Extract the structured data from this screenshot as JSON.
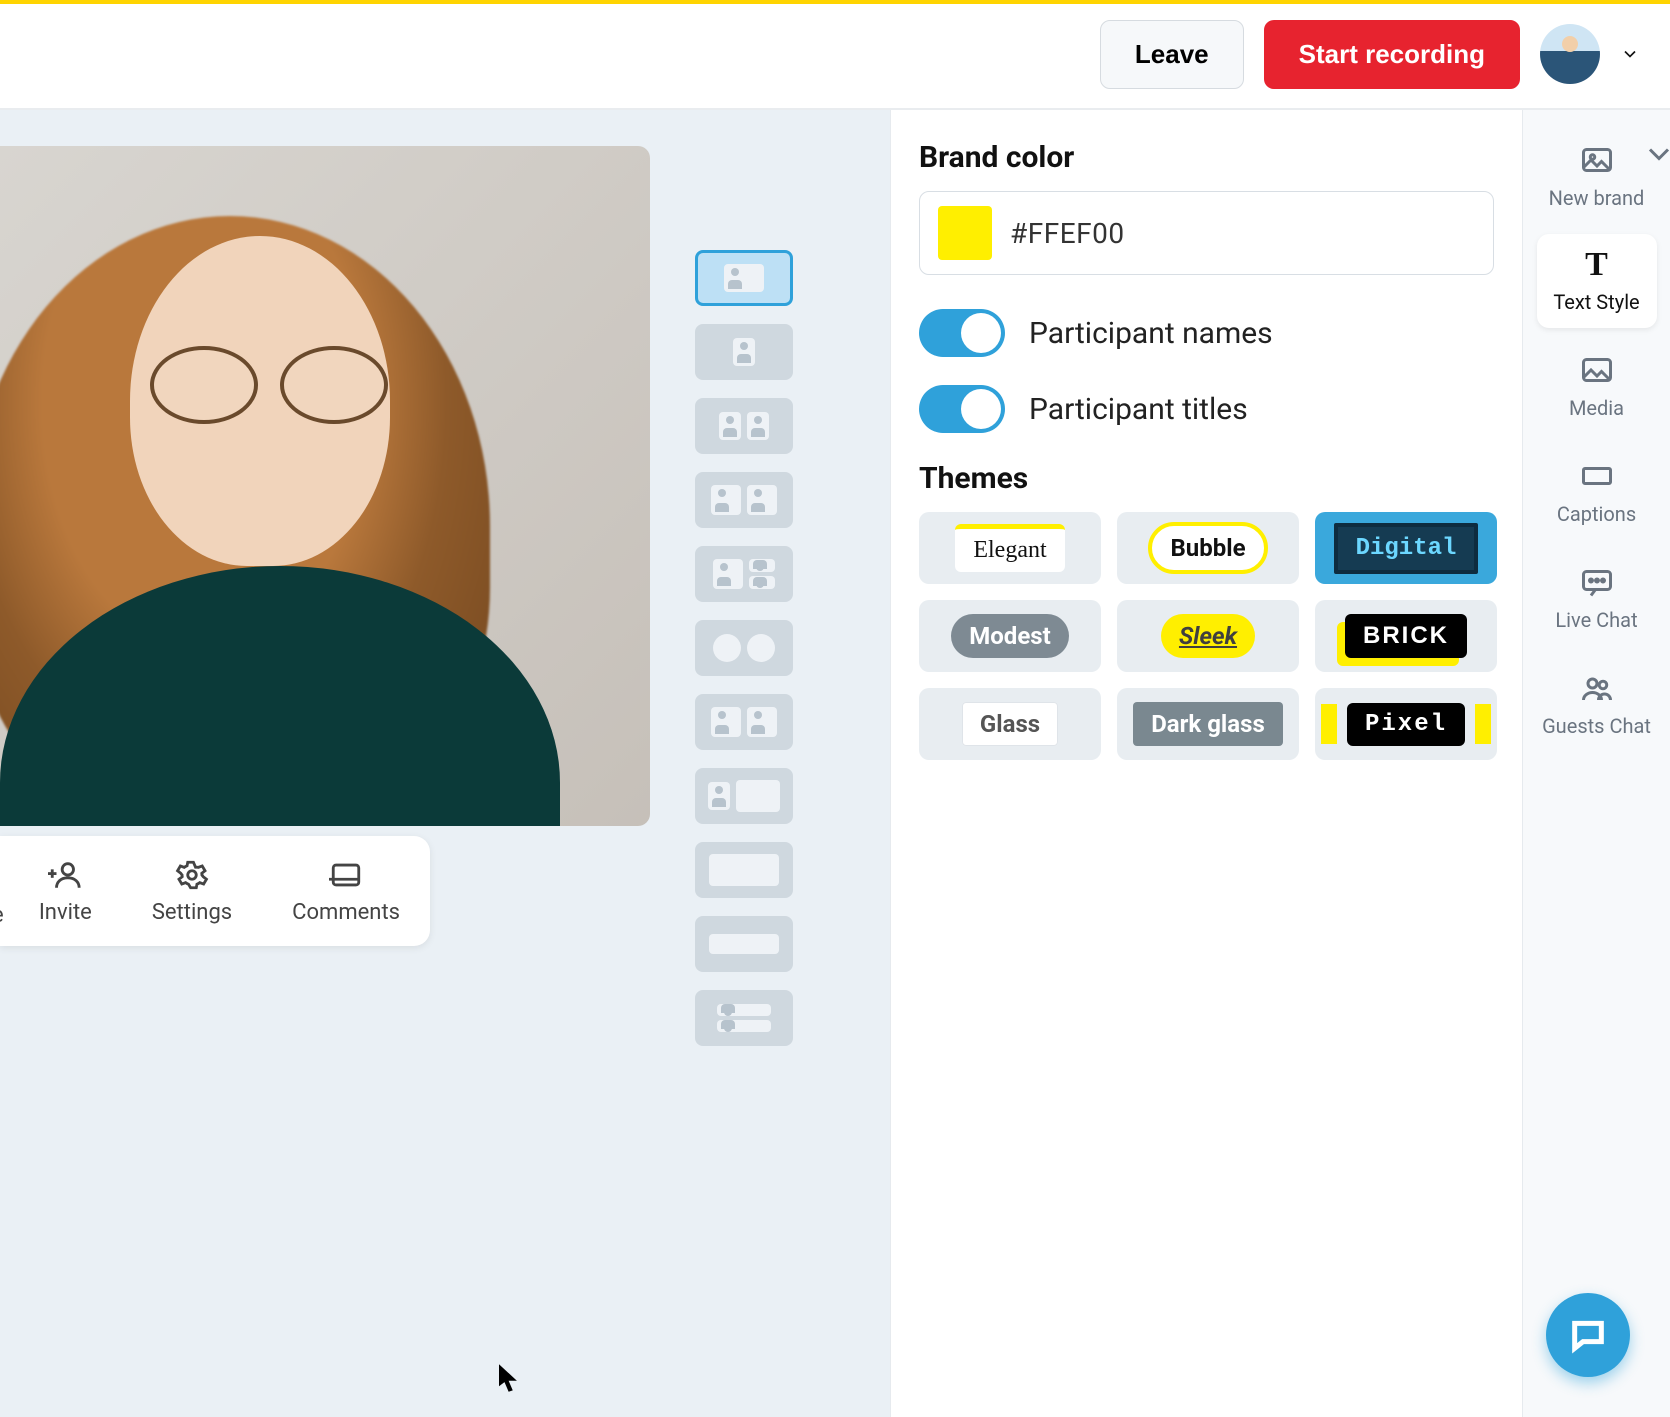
{
  "header": {
    "leave_label": "Leave",
    "record_label": "Start recording"
  },
  "controls_bar": {
    "partial_label_left": "e",
    "invite": "Invite",
    "settings": "Settings",
    "comments": "Comments"
  },
  "panel": {
    "brand_color_heading": "Brand color",
    "brand_color_value": "#FFEF00",
    "toggles": {
      "participant_names": {
        "label": "Participant names",
        "on": true
      },
      "participant_titles": {
        "label": "Participant titles",
        "on": true
      }
    },
    "themes_heading": "Themes",
    "themes": [
      {
        "id": "elegant",
        "label": "Elegant",
        "selected": false
      },
      {
        "id": "bubble",
        "label": "Bubble",
        "selected": false
      },
      {
        "id": "digital",
        "label": "Digital",
        "selected": true
      },
      {
        "id": "modest",
        "label": "Modest",
        "selected": false
      },
      {
        "id": "sleek",
        "label": "Sleek",
        "selected": false
      },
      {
        "id": "brick",
        "label": "BRICK",
        "selected": false
      },
      {
        "id": "glass",
        "label": "Glass",
        "selected": false
      },
      {
        "id": "darkglass",
        "label": "Dark glass",
        "selected": false
      },
      {
        "id": "pixel",
        "label": "Pixel",
        "selected": false
      }
    ]
  },
  "rail": {
    "new_brand": "New brand",
    "text_style": "Text Style",
    "media": "Media",
    "captions": "Captions",
    "live_chat": "Live Chat",
    "guests_chat": "Guests Chat"
  },
  "layout_selected_index": 0,
  "colors": {
    "accent": "#2fa1da",
    "brand": "#ffef00",
    "danger": "#e7232f"
  }
}
